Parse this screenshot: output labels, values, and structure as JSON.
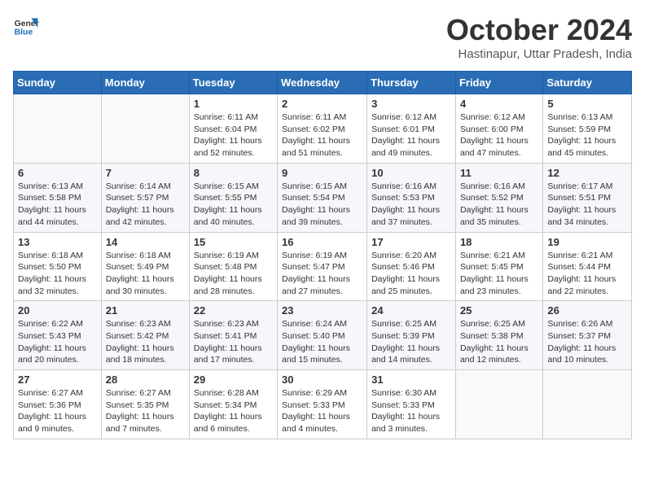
{
  "logo": {
    "line1": "General",
    "line2": "Blue"
  },
  "title": "October 2024",
  "subtitle": "Hastinapur, Uttar Pradesh, India",
  "days_of_week": [
    "Sunday",
    "Monday",
    "Tuesday",
    "Wednesday",
    "Thursday",
    "Friday",
    "Saturday"
  ],
  "weeks": [
    [
      {
        "day": "",
        "info": ""
      },
      {
        "day": "",
        "info": ""
      },
      {
        "day": "1",
        "info": "Sunrise: 6:11 AM\nSunset: 6:04 PM\nDaylight: 11 hours and 52 minutes."
      },
      {
        "day": "2",
        "info": "Sunrise: 6:11 AM\nSunset: 6:02 PM\nDaylight: 11 hours and 51 minutes."
      },
      {
        "day": "3",
        "info": "Sunrise: 6:12 AM\nSunset: 6:01 PM\nDaylight: 11 hours and 49 minutes."
      },
      {
        "day": "4",
        "info": "Sunrise: 6:12 AM\nSunset: 6:00 PM\nDaylight: 11 hours and 47 minutes."
      },
      {
        "day": "5",
        "info": "Sunrise: 6:13 AM\nSunset: 5:59 PM\nDaylight: 11 hours and 45 minutes."
      }
    ],
    [
      {
        "day": "6",
        "info": "Sunrise: 6:13 AM\nSunset: 5:58 PM\nDaylight: 11 hours and 44 minutes."
      },
      {
        "day": "7",
        "info": "Sunrise: 6:14 AM\nSunset: 5:57 PM\nDaylight: 11 hours and 42 minutes."
      },
      {
        "day": "8",
        "info": "Sunrise: 6:15 AM\nSunset: 5:55 PM\nDaylight: 11 hours and 40 minutes."
      },
      {
        "day": "9",
        "info": "Sunrise: 6:15 AM\nSunset: 5:54 PM\nDaylight: 11 hours and 39 minutes."
      },
      {
        "day": "10",
        "info": "Sunrise: 6:16 AM\nSunset: 5:53 PM\nDaylight: 11 hours and 37 minutes."
      },
      {
        "day": "11",
        "info": "Sunrise: 6:16 AM\nSunset: 5:52 PM\nDaylight: 11 hours and 35 minutes."
      },
      {
        "day": "12",
        "info": "Sunrise: 6:17 AM\nSunset: 5:51 PM\nDaylight: 11 hours and 34 minutes."
      }
    ],
    [
      {
        "day": "13",
        "info": "Sunrise: 6:18 AM\nSunset: 5:50 PM\nDaylight: 11 hours and 32 minutes."
      },
      {
        "day": "14",
        "info": "Sunrise: 6:18 AM\nSunset: 5:49 PM\nDaylight: 11 hours and 30 minutes."
      },
      {
        "day": "15",
        "info": "Sunrise: 6:19 AM\nSunset: 5:48 PM\nDaylight: 11 hours and 28 minutes."
      },
      {
        "day": "16",
        "info": "Sunrise: 6:19 AM\nSunset: 5:47 PM\nDaylight: 11 hours and 27 minutes."
      },
      {
        "day": "17",
        "info": "Sunrise: 6:20 AM\nSunset: 5:46 PM\nDaylight: 11 hours and 25 minutes."
      },
      {
        "day": "18",
        "info": "Sunrise: 6:21 AM\nSunset: 5:45 PM\nDaylight: 11 hours and 23 minutes."
      },
      {
        "day": "19",
        "info": "Sunrise: 6:21 AM\nSunset: 5:44 PM\nDaylight: 11 hours and 22 minutes."
      }
    ],
    [
      {
        "day": "20",
        "info": "Sunrise: 6:22 AM\nSunset: 5:43 PM\nDaylight: 11 hours and 20 minutes."
      },
      {
        "day": "21",
        "info": "Sunrise: 6:23 AM\nSunset: 5:42 PM\nDaylight: 11 hours and 18 minutes."
      },
      {
        "day": "22",
        "info": "Sunrise: 6:23 AM\nSunset: 5:41 PM\nDaylight: 11 hours and 17 minutes."
      },
      {
        "day": "23",
        "info": "Sunrise: 6:24 AM\nSunset: 5:40 PM\nDaylight: 11 hours and 15 minutes."
      },
      {
        "day": "24",
        "info": "Sunrise: 6:25 AM\nSunset: 5:39 PM\nDaylight: 11 hours and 14 minutes."
      },
      {
        "day": "25",
        "info": "Sunrise: 6:25 AM\nSunset: 5:38 PM\nDaylight: 11 hours and 12 minutes."
      },
      {
        "day": "26",
        "info": "Sunrise: 6:26 AM\nSunset: 5:37 PM\nDaylight: 11 hours and 10 minutes."
      }
    ],
    [
      {
        "day": "27",
        "info": "Sunrise: 6:27 AM\nSunset: 5:36 PM\nDaylight: 11 hours and 9 minutes."
      },
      {
        "day": "28",
        "info": "Sunrise: 6:27 AM\nSunset: 5:35 PM\nDaylight: 11 hours and 7 minutes."
      },
      {
        "day": "29",
        "info": "Sunrise: 6:28 AM\nSunset: 5:34 PM\nDaylight: 11 hours and 6 minutes."
      },
      {
        "day": "30",
        "info": "Sunrise: 6:29 AM\nSunset: 5:33 PM\nDaylight: 11 hours and 4 minutes."
      },
      {
        "day": "31",
        "info": "Sunrise: 6:30 AM\nSunset: 5:33 PM\nDaylight: 11 hours and 3 minutes."
      },
      {
        "day": "",
        "info": ""
      },
      {
        "day": "",
        "info": ""
      }
    ]
  ]
}
